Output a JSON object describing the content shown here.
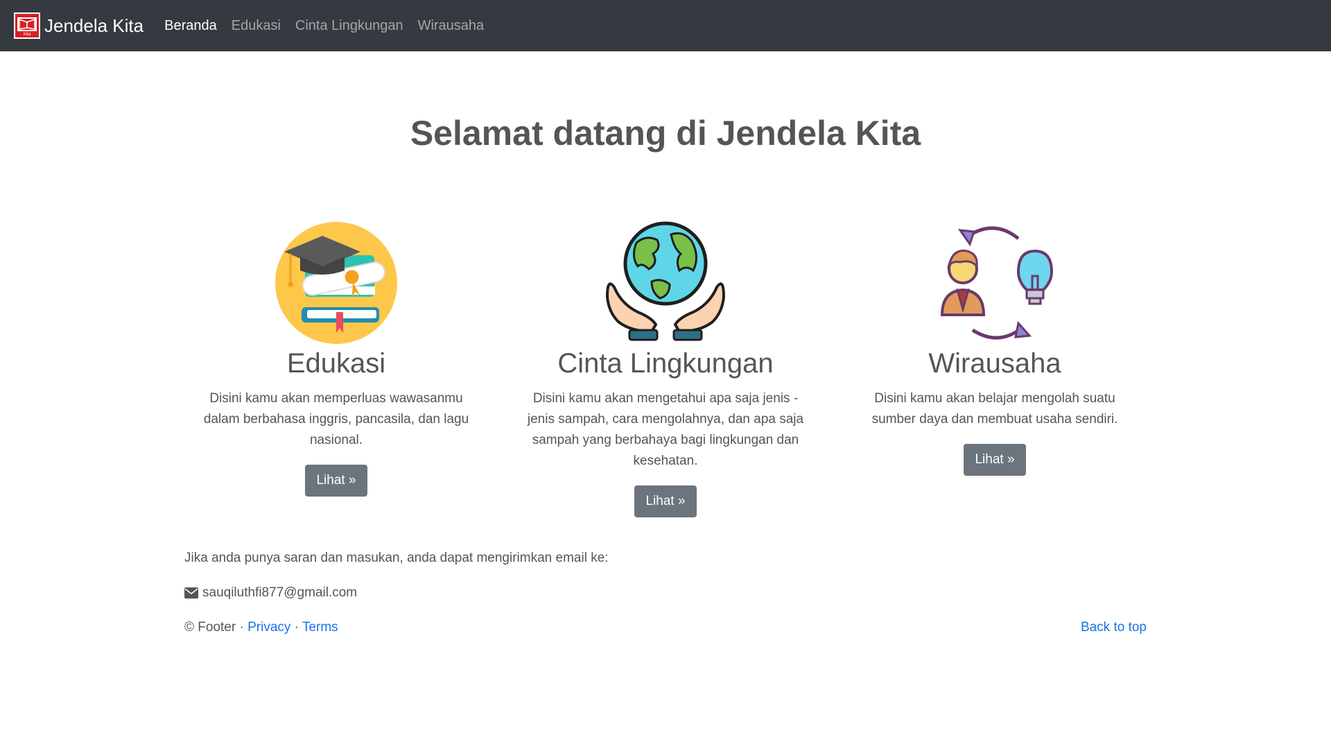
{
  "navbar": {
    "brand": "Jendela Kita",
    "logo_text": "Kita",
    "links": [
      "Beranda",
      "Edukasi",
      "Cinta Lingkungan",
      "Wirausaha"
    ]
  },
  "hero": {
    "title": "Selamat datang di Jendela Kita"
  },
  "features": [
    {
      "icon": "graduation-books-icon",
      "title": "Edukasi",
      "desc": "Disini kamu akan memperluas wawasanmu dalam berbahasa inggris, pancasila, dan lagu nasional.",
      "button": "Lihat »"
    },
    {
      "icon": "globe-hands-icon",
      "title": "Cinta Lingkungan",
      "desc": "Disini kamu akan mengetahui apa saja jenis - jenis sampah, cara mengolahnya, dan apa saja sampah yang berbahaya bagi lingkungan dan kesehatan.",
      "button": "Lihat »"
    },
    {
      "icon": "person-idea-cycle-icon",
      "title": "Wirausaha",
      "desc": "Disini kamu akan belajar mengolah suatu sumber daya dan membuat usaha sendiri.",
      "button": "Lihat »"
    }
  ],
  "footer": {
    "note": "Jika anda punya saran dan masukan, anda dapat mengirimkan email ke:",
    "email": "sauqiluthfi877@gmail.com",
    "copyright": "© Footer",
    "separator": "·",
    "privacy": "Privacy",
    "terms": "Terms",
    "back_to_top": "Back to top"
  },
  "colors": {
    "navbar_bg": "#343a40",
    "button_bg": "#6c757d",
    "link": "#1a73e8",
    "heading": "#555555"
  }
}
